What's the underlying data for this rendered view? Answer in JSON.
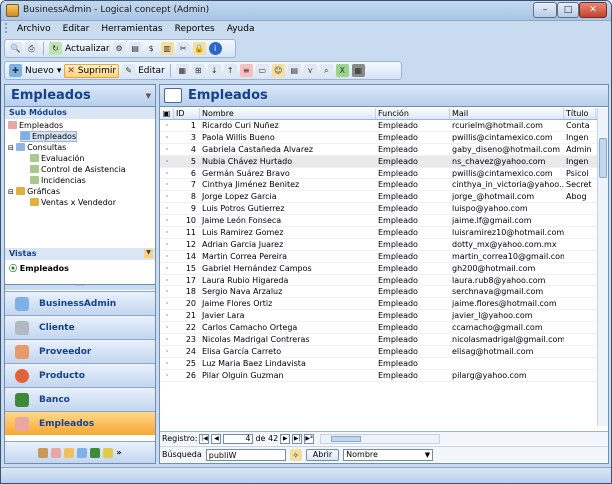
{
  "window": {
    "title": "BusinessAdmin - Logical concept (Admin)",
    "min": "–",
    "max": "□",
    "close": "✕"
  },
  "menu": [
    "Archivo",
    "Editar",
    "Herramientas",
    "Reportes",
    "Ayuda"
  ],
  "toolbar1": {
    "actualizar": "Actualizar",
    "dollar": "$"
  },
  "toolbar2": {
    "nuevo": "Nuevo",
    "suprimir": "Suprimir",
    "editar": "Editar"
  },
  "left": {
    "title": "Empleados",
    "submodulos": "Sub Módulos",
    "tree": {
      "empleados": "Empleados",
      "empleados_child": "Empleados",
      "consultas": "Consultas",
      "evaluacion": "Evaluación",
      "control": "Control de Asistencia",
      "incidencias": "Incidencias",
      "graficas": "Gráficas",
      "ventas": "Ventas x Vendedor"
    },
    "vistas": "Vistas",
    "vista_sel": "Empleados",
    "nav": [
      "BusinessAdmin",
      "Cliente",
      "Proveedor",
      "Producto",
      "Banco",
      "Empleados"
    ]
  },
  "right": {
    "title": "Empleados",
    "columns": [
      "ID",
      "Nombre",
      "Función",
      "Mail",
      "Título"
    ],
    "rows": [
      [
        "1",
        "Ricardo Curi Nuñez",
        "Empleado",
        "rcurielm@hotmail.com",
        "Conta"
      ],
      [
        "3",
        "Paola Willis Bueno",
        "Empleado",
        "pwillis@cintamexico.com",
        "Ingen"
      ],
      [
        "4",
        "Gabriela Castañeda Alvarez",
        "Empleado",
        "gaby_diseno@hotmail.com",
        "Admin"
      ],
      [
        "5",
        "Nubia Chávez Hurtado",
        "Empleado",
        "ns_chavez@yahoo.com",
        "Ingen"
      ],
      [
        "6",
        "Germán  Suárez Bravo",
        "Empleado",
        "pwillis@cintamexico.com",
        "Psicol"
      ],
      [
        "7",
        "Cinthya Jiménez Benitez",
        "Empleado",
        "cinthya_in_victoria@yahoo....",
        "Secret"
      ],
      [
        "8",
        "Jorge Lopez Garcia",
        "Empleado",
        "jorge_@hotmail.com",
        "Abog"
      ],
      [
        "9",
        "Luis Potros Gutierrez",
        "Empleado",
        "luispo@yahoo.com",
        ""
      ],
      [
        "10",
        "Jaime León Fonseca",
        "Empleado",
        "jaime.lf@gmail.com",
        ""
      ],
      [
        "11",
        "Luis Ramirez Gomez",
        "Empleado",
        "luisramirez10@hotmail.com",
        ""
      ],
      [
        "12",
        "Adrian Garcia Juarez",
        "Empleado",
        "dotty_mx@yahoo.com.mx",
        ""
      ],
      [
        "14",
        "Martin Correa Pereira",
        "Empleado",
        "martin_correa10@gmail.com",
        ""
      ],
      [
        "15",
        "Gabriel Hernández Campos",
        "Empleado",
        "gh200@hotmail.com",
        ""
      ],
      [
        "17",
        "Laura  Rubio Higareda",
        "Empleado",
        "laura.rub8@yahoo.com",
        ""
      ],
      [
        "18",
        "Sergio Nava Arzaluz",
        "Empleado",
        "serchnava@gmail.com",
        ""
      ],
      [
        "20",
        "Jaime Flores Ortiz",
        "Empleado",
        "jaime.flores@hotmail.com",
        ""
      ],
      [
        "21",
        "Javier Lara",
        "Empleado",
        "javier_l@yahoo.com",
        ""
      ],
      [
        "22",
        "Carlos Camacho Ortega",
        "Empleado",
        "ccamacho@gmail.com",
        ""
      ],
      [
        "23",
        "Nicolas Madrigal Contreras",
        "Empleado",
        "nicolasmadrigal@gmail.com",
        ""
      ],
      [
        "24",
        "Elisa García Carreto",
        "Empleado",
        "elisag@hotmail.com",
        ""
      ],
      [
        "25",
        "Luz Maria Baez Lindavista",
        "Empleado",
        "",
        ""
      ],
      [
        "26",
        "Pilar Olguin Guzman",
        "Empleado",
        "pilarg@yahoo.com",
        ""
      ]
    ],
    "selected_row": 3,
    "registro_label": "Registro:",
    "registro_current": "4",
    "registro_of": "de 42",
    "busqueda_label": "Búsqueda",
    "busqueda_value": "publiW",
    "abrir": "Abrir",
    "campo": "Nombre"
  }
}
